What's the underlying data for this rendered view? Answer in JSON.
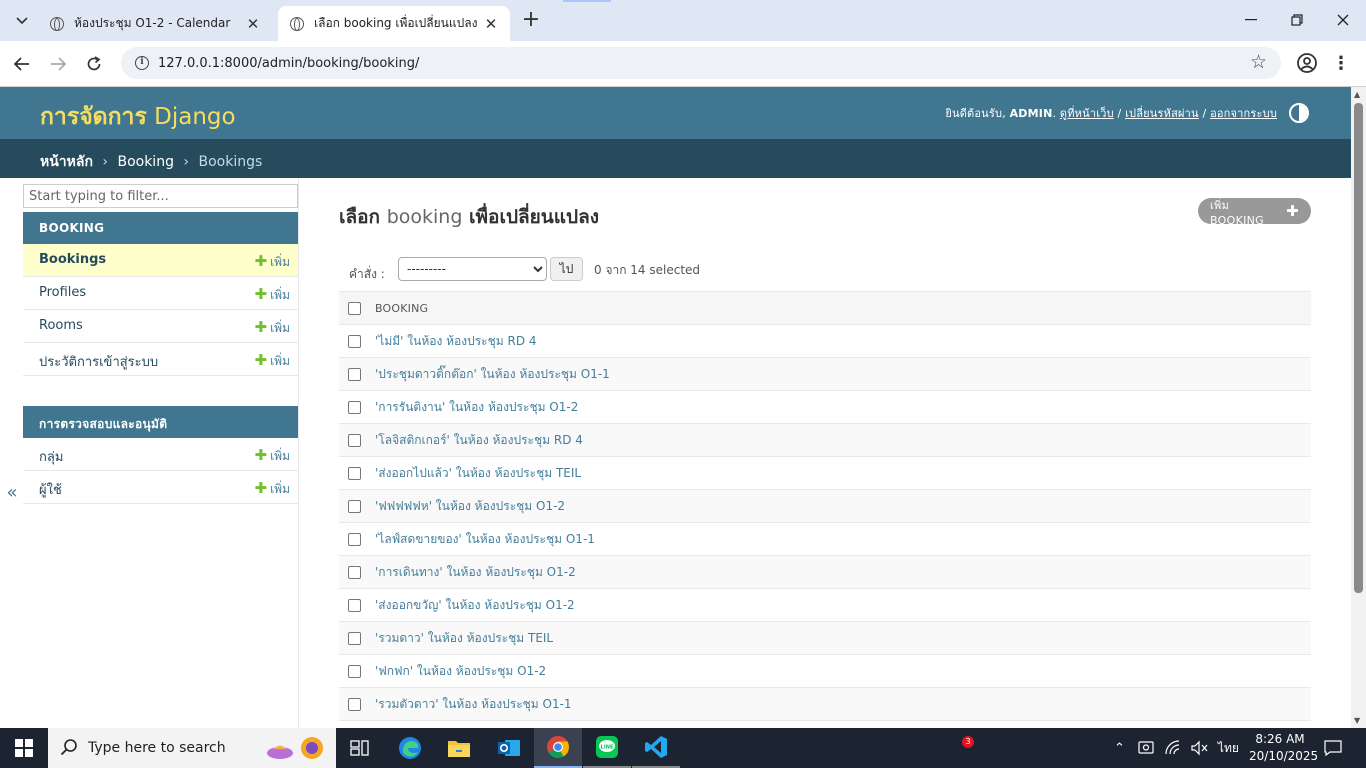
{
  "browser": {
    "tabs": [
      {
        "title": "ห้องประชุม O1-2 - Calendar",
        "active": false
      },
      {
        "title": "เลือก booking เพื่อเปลี่ยนแปลง | ผู้ดูแลระบบ Django",
        "active": true
      }
    ],
    "url": "127.0.0.1:8000/admin/booking/booking/"
  },
  "header": {
    "site_name_thai": "การจัดการ",
    "site_name_django": "Django",
    "welcome": "ยินดีต้อนรับ, ",
    "username": "ADMIN",
    "view_site": "ดูที่หน้าเว็บ",
    "change_password": "เปลี่ยนรหัสผ่าน",
    "logout": "ออกจากระบบ",
    "sep1": ". ",
    "sep2": " / ",
    "sep3": " / "
  },
  "breadcrumbs": {
    "home": "หน้าหลัก",
    "app": "Booking",
    "current": "Bookings",
    "separator": "›"
  },
  "sidebar": {
    "filter_placeholder": "Start typing to filter...",
    "modules": [
      {
        "caption": "BOOKING",
        "rows": [
          {
            "label": "Bookings",
            "add": "เพิ่ม",
            "current": true
          },
          {
            "label": "Profiles",
            "add": "เพิ่ม"
          },
          {
            "label": "Rooms",
            "add": "เพิ่ม"
          },
          {
            "label": "ประวัติการเข้าสู่ระบบ",
            "add": "เพิ่ม"
          }
        ]
      },
      {
        "caption": "การตรวจสอบและอนุมัติ",
        "rows": [
          {
            "label": "กลุ่ม",
            "add": "เพิ่ม"
          },
          {
            "label": "ผู้ใช้",
            "add": "เพิ่ม"
          }
        ]
      }
    ],
    "toggle_label": "«"
  },
  "content": {
    "title_prefix": "เลือก",
    "title_model": "booking",
    "title_suffix": "เพื่อเปลี่ยนแปลง",
    "add_button": "เพิ่ม BOOKING",
    "actions": {
      "label": "คำสั่ง :",
      "selected_option": "---------",
      "go_label": "ไป",
      "counter": "0 จาก 14 selected"
    },
    "table_header": "BOOKING",
    "rows": [
      "'ไม่มี' ในห้อง ห้องประชุม RD 4",
      "'ประชุมดาวติ๊กต๊อก' ในห้อง ห้องประชุม O1-1",
      "'การรันติงาน' ในห้อง ห้องประชุม O1-2",
      "'โลจิสติกเกอร์' ในห้อง ห้องประชุม RD 4",
      "'ส่งออกไปแล้ว' ในห้อง ห้องประชุม TEIL",
      "'ฟฟฟฟฟห' ในห้อง ห้องประชุม O1-2",
      "'ไลฟ์สดขายของ' ในห้อง ห้องประชุม O1-1",
      "'การเดินทาง' ในห้อง ห้องประชุม O1-2",
      "'ส่งออกขวัญ' ในห้อง ห้องประชุม O1-2",
      "'รวมดาว' ในห้อง ห้องประชุม TEIL",
      "'ฟกฟก' ในห้อง ห้องประชุม O1-2",
      "'รวมตัวดาว' ในห้อง ห้องประชุม O1-1"
    ]
  },
  "taskbar": {
    "search_placeholder": "Type here to search",
    "notification_count": "3",
    "language": "ไทย",
    "time": "8:26 AM",
    "date": "20/10/2025"
  },
  "colors": {
    "header_bg": "#417690",
    "breadcrumb_bg": "#264b5d",
    "branding": "#f5dd5d",
    "link": "#447e9b",
    "addlink_plus": "#70bf2b",
    "current_row": "#ffffcc"
  }
}
